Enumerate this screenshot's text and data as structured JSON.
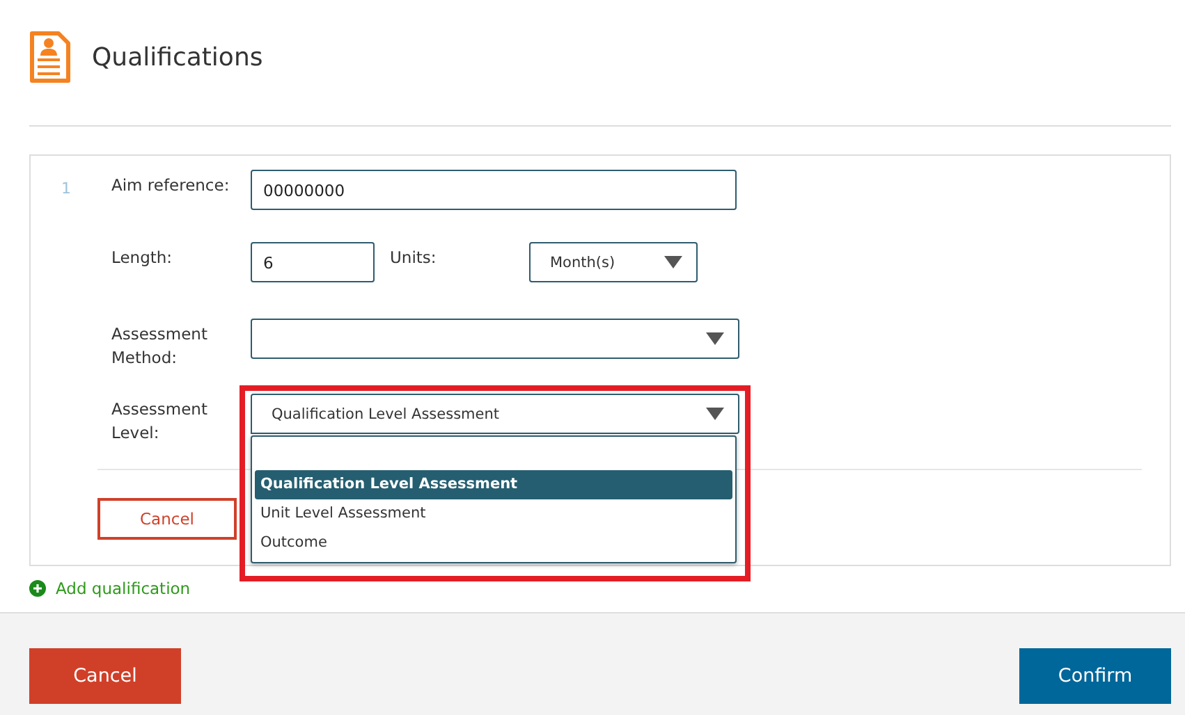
{
  "header": {
    "title": "Qualifications"
  },
  "qualification": {
    "number": "1",
    "aim_reference": {
      "label": "Aim reference:",
      "value": "00000000"
    },
    "length": {
      "label": "Length:",
      "value": "6"
    },
    "units": {
      "label": "Units:",
      "value": "Month(s)"
    },
    "assessment_method": {
      "label": "Assessment Method:"
    },
    "assessment_level": {
      "label": "Assessment Level:",
      "value": "Qualification Level Assessment",
      "expanded": true,
      "options": [
        {
          "label": "Qualification Level Assessment",
          "selected": true
        },
        {
          "label": "Unit Level Assessment",
          "selected": false
        },
        {
          "label": "Outcome",
          "selected": false
        }
      ]
    },
    "cancel_button": "Cancel"
  },
  "add_qualification": "Add qualification",
  "footer": {
    "cancel": "Cancel",
    "confirm": "Confirm"
  }
}
